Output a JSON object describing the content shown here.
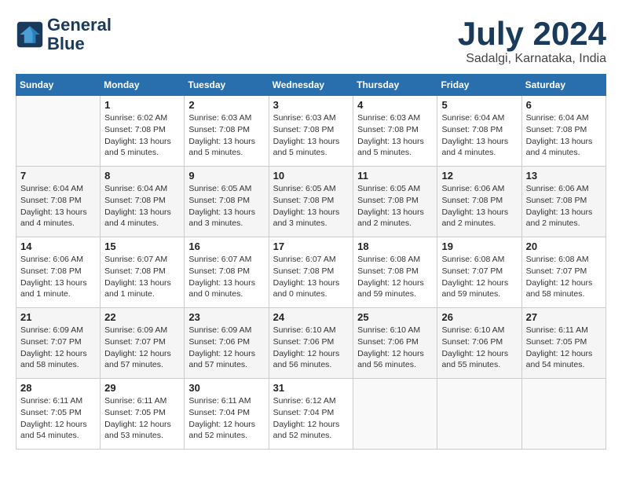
{
  "header": {
    "logo_line1": "General",
    "logo_line2": "Blue",
    "month_year": "July 2024",
    "location": "Sadalgi, Karnataka, India"
  },
  "weekdays": [
    "Sunday",
    "Monday",
    "Tuesday",
    "Wednesday",
    "Thursday",
    "Friday",
    "Saturday"
  ],
  "weeks": [
    [
      {
        "day": "",
        "info": ""
      },
      {
        "day": "1",
        "info": "Sunrise: 6:02 AM\nSunset: 7:08 PM\nDaylight: 13 hours\nand 5 minutes."
      },
      {
        "day": "2",
        "info": "Sunrise: 6:03 AM\nSunset: 7:08 PM\nDaylight: 13 hours\nand 5 minutes."
      },
      {
        "day": "3",
        "info": "Sunrise: 6:03 AM\nSunset: 7:08 PM\nDaylight: 13 hours\nand 5 minutes."
      },
      {
        "day": "4",
        "info": "Sunrise: 6:03 AM\nSunset: 7:08 PM\nDaylight: 13 hours\nand 5 minutes."
      },
      {
        "day": "5",
        "info": "Sunrise: 6:04 AM\nSunset: 7:08 PM\nDaylight: 13 hours\nand 4 minutes."
      },
      {
        "day": "6",
        "info": "Sunrise: 6:04 AM\nSunset: 7:08 PM\nDaylight: 13 hours\nand 4 minutes."
      }
    ],
    [
      {
        "day": "7",
        "info": "Sunrise: 6:04 AM\nSunset: 7:08 PM\nDaylight: 13 hours\nand 4 minutes."
      },
      {
        "day": "8",
        "info": "Sunrise: 6:04 AM\nSunset: 7:08 PM\nDaylight: 13 hours\nand 4 minutes."
      },
      {
        "day": "9",
        "info": "Sunrise: 6:05 AM\nSunset: 7:08 PM\nDaylight: 13 hours\nand 3 minutes."
      },
      {
        "day": "10",
        "info": "Sunrise: 6:05 AM\nSunset: 7:08 PM\nDaylight: 13 hours\nand 3 minutes."
      },
      {
        "day": "11",
        "info": "Sunrise: 6:05 AM\nSunset: 7:08 PM\nDaylight: 13 hours\nand 2 minutes."
      },
      {
        "day": "12",
        "info": "Sunrise: 6:06 AM\nSunset: 7:08 PM\nDaylight: 13 hours\nand 2 minutes."
      },
      {
        "day": "13",
        "info": "Sunrise: 6:06 AM\nSunset: 7:08 PM\nDaylight: 13 hours\nand 2 minutes."
      }
    ],
    [
      {
        "day": "14",
        "info": "Sunrise: 6:06 AM\nSunset: 7:08 PM\nDaylight: 13 hours\nand 1 minute."
      },
      {
        "day": "15",
        "info": "Sunrise: 6:07 AM\nSunset: 7:08 PM\nDaylight: 13 hours\nand 1 minute."
      },
      {
        "day": "16",
        "info": "Sunrise: 6:07 AM\nSunset: 7:08 PM\nDaylight: 13 hours\nand 0 minutes."
      },
      {
        "day": "17",
        "info": "Sunrise: 6:07 AM\nSunset: 7:08 PM\nDaylight: 13 hours\nand 0 minutes."
      },
      {
        "day": "18",
        "info": "Sunrise: 6:08 AM\nSunset: 7:08 PM\nDaylight: 12 hours\nand 59 minutes."
      },
      {
        "day": "19",
        "info": "Sunrise: 6:08 AM\nSunset: 7:07 PM\nDaylight: 12 hours\nand 59 minutes."
      },
      {
        "day": "20",
        "info": "Sunrise: 6:08 AM\nSunset: 7:07 PM\nDaylight: 12 hours\nand 58 minutes."
      }
    ],
    [
      {
        "day": "21",
        "info": "Sunrise: 6:09 AM\nSunset: 7:07 PM\nDaylight: 12 hours\nand 58 minutes."
      },
      {
        "day": "22",
        "info": "Sunrise: 6:09 AM\nSunset: 7:07 PM\nDaylight: 12 hours\nand 57 minutes."
      },
      {
        "day": "23",
        "info": "Sunrise: 6:09 AM\nSunset: 7:06 PM\nDaylight: 12 hours\nand 57 minutes."
      },
      {
        "day": "24",
        "info": "Sunrise: 6:10 AM\nSunset: 7:06 PM\nDaylight: 12 hours\nand 56 minutes."
      },
      {
        "day": "25",
        "info": "Sunrise: 6:10 AM\nSunset: 7:06 PM\nDaylight: 12 hours\nand 56 minutes."
      },
      {
        "day": "26",
        "info": "Sunrise: 6:10 AM\nSunset: 7:06 PM\nDaylight: 12 hours\nand 55 minutes."
      },
      {
        "day": "27",
        "info": "Sunrise: 6:11 AM\nSunset: 7:05 PM\nDaylight: 12 hours\nand 54 minutes."
      }
    ],
    [
      {
        "day": "28",
        "info": "Sunrise: 6:11 AM\nSunset: 7:05 PM\nDaylight: 12 hours\nand 54 minutes."
      },
      {
        "day": "29",
        "info": "Sunrise: 6:11 AM\nSunset: 7:05 PM\nDaylight: 12 hours\nand 53 minutes."
      },
      {
        "day": "30",
        "info": "Sunrise: 6:11 AM\nSunset: 7:04 PM\nDaylight: 12 hours\nand 52 minutes."
      },
      {
        "day": "31",
        "info": "Sunrise: 6:12 AM\nSunset: 7:04 PM\nDaylight: 12 hours\nand 52 minutes."
      },
      {
        "day": "",
        "info": ""
      },
      {
        "day": "",
        "info": ""
      },
      {
        "day": "",
        "info": ""
      }
    ]
  ]
}
